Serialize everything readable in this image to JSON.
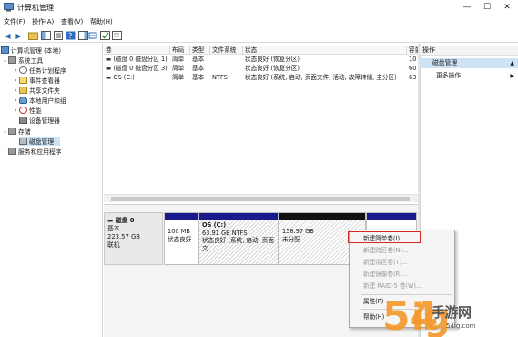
{
  "window": {
    "title": "计算机管理"
  },
  "menu": [
    "文件(F)",
    "操作(A)",
    "查看(V)",
    "帮助(H)"
  ],
  "tree": {
    "root": "计算机管理 (本地)",
    "system_tools": "系统工具",
    "task_scheduler": "任务计划程序",
    "event_viewer": "事件查看器",
    "shared_folders": "共享文件夹",
    "local_users": "本地用户和组",
    "performance": "性能",
    "device_manager": "设备管理器",
    "storage": "存储",
    "disk_management": "磁盘管理",
    "services_apps": "服务和应用程序"
  },
  "volume_list": {
    "columns": [
      "卷",
      "布局",
      "类型",
      "文件系统",
      "状态",
      "容量"
    ],
    "rows": [
      {
        "vol": "(磁盘 0 磁盘分区 1)",
        "layout": "简单",
        "type": "基本",
        "fs": "",
        "status": "状态良好 (恢复分区)",
        "cap": "10"
      },
      {
        "vol": "(磁盘 0 磁盘分区 3)",
        "layout": "简单",
        "type": "基本",
        "fs": "",
        "status": "状态良好 (恢复分区)",
        "cap": "60"
      },
      {
        "vol": "OS (C:)",
        "layout": "简单",
        "type": "基本",
        "fs": "NTFS",
        "status": "状态良好 (系统, 启动, 页面文件, 活动, 故障转储, 主分区)",
        "cap": "63"
      }
    ]
  },
  "disk": {
    "name": "磁盘 0",
    "type": "基本",
    "size": "223.57 GB",
    "status": "联机",
    "partitions": [
      {
        "line1": "100 MB",
        "line2": "状态良好"
      },
      {
        "line0": "OS  (C:)",
        "line1": "63.91 GB NTFS",
        "line2": "状态良好 (系统, 启动, 页面文"
      },
      {
        "line1": "158.97 GB",
        "line2": "未分配"
      }
    ]
  },
  "actions": {
    "title": "操作",
    "section": "磁盘管理",
    "more": "更多操作"
  },
  "context_menu": [
    {
      "label": "新建简单卷(I)...",
      "disabled": false
    },
    {
      "label": "新建跨区卷(N)...",
      "disabled": true
    },
    {
      "label": "新建带区卷(T)...",
      "disabled": true
    },
    {
      "label": "新建镜像卷(R)...",
      "disabled": true
    },
    {
      "label": "新建 RAID-5 卷(W)...",
      "disabled": true
    },
    {
      "label": "属性(P)",
      "disabled": false
    },
    {
      "label": "帮助(H)",
      "disabled": false
    }
  ],
  "watermark": {
    "text": "手游网",
    "url": "54ig.com"
  }
}
